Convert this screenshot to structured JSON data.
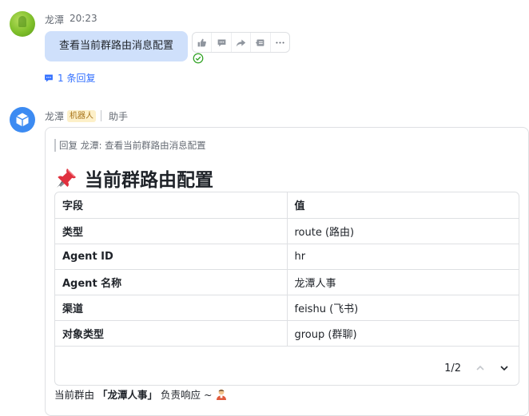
{
  "msg1": {
    "sender": "龙潭",
    "time": "20:23",
    "text": "查看当前群路由消息配置",
    "reply_link": "1 条回复"
  },
  "msg2": {
    "sender": "龙潭",
    "bot_badge": "机器人",
    "assistant_label": "助手",
    "quote": "回复 龙潭:  查看当前群路由消息配置",
    "title": "当前群路由配置",
    "table": {
      "headers": [
        "字段",
        "值"
      ],
      "rows": [
        [
          "类型",
          "route (路由)"
        ],
        [
          "Agent ID",
          "hr"
        ],
        [
          "Agent 名称",
          "龙潭人事"
        ],
        [
          "渠道",
          "feishu (飞书)"
        ],
        [
          "对象类型",
          "group (群聊)"
        ]
      ],
      "pager": "1/2"
    },
    "footer_prefix": "当前群由",
    "footer_name": "「龙潭人事」",
    "footer_suffix": "负责响应 ~"
  },
  "colors": {
    "accent": "#3370ff",
    "bubble": "#cfe0fb",
    "bot_badge_bg": "#fdf0c9",
    "check": "#2ea121"
  }
}
